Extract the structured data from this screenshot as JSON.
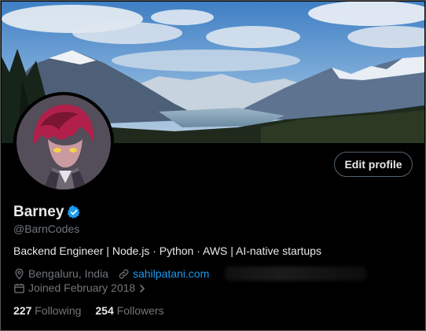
{
  "profile": {
    "display_name": "Barney",
    "handle": "@BarnCodes",
    "bio": "Backend Engineer | Node.js · Python · AWS | AI-native startups",
    "verified": true,
    "edit_profile_label": "Edit profile",
    "location": "Bengaluru, India",
    "website": "sahilpatani.com",
    "joined": "Joined February 2018",
    "following_count": "227",
    "following_label": "Following",
    "followers_count": "254",
    "followers_label": "Followers"
  },
  "icons": {
    "verified": "verified-badge-icon",
    "location": "location-pin-icon",
    "website": "link-icon",
    "joined": "calendar-icon",
    "joined_chevron": "chevron-right-icon"
  },
  "colors": {
    "background": "#000000",
    "text_primary": "#e7e9ea",
    "text_secondary": "#71767b",
    "accent": "#1d9bf0"
  }
}
